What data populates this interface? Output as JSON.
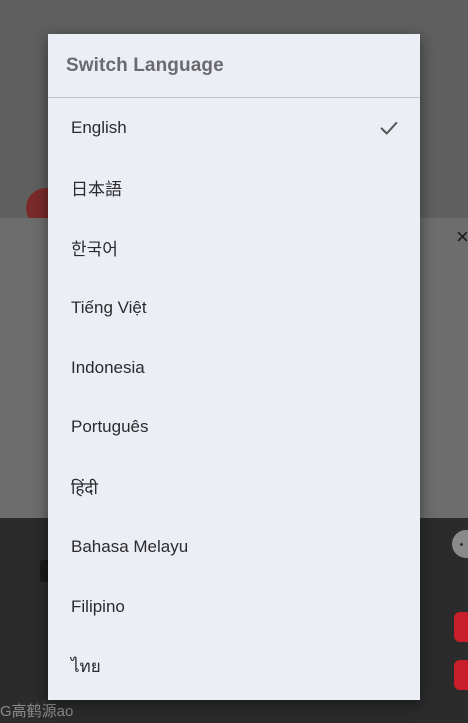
{
  "dialog": {
    "title": "Switch Language",
    "selected_index": 0,
    "languages": [
      {
        "label": "English",
        "selected": true
      },
      {
        "label": "日本語",
        "selected": false
      },
      {
        "label": "한국어",
        "selected": false
      },
      {
        "label": "Tiếng Việt",
        "selected": false
      },
      {
        "label": "Indonesia",
        "selected": false
      },
      {
        "label": "Português",
        "selected": false
      },
      {
        "label": "हिंदी",
        "selected": false
      },
      {
        "label": "Bahasa Melayu",
        "selected": false
      },
      {
        "label": "Filipino",
        "selected": false
      },
      {
        "label": "ไทย",
        "selected": false
      }
    ],
    "check_icon": "checkmark-icon"
  },
  "background": {
    "caption": "G高鹤源ao",
    "close_glyph": "×"
  },
  "colors": {
    "dialog_bg": "#eceef6",
    "title_text": "#6b6b6f",
    "item_text": "#2b2b2e",
    "check": "#555555"
  }
}
